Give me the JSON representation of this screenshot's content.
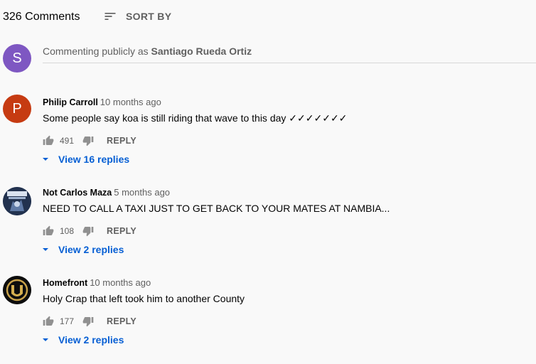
{
  "header": {
    "comment_count": "326 Comments",
    "sort_label": "SORT BY"
  },
  "compose": {
    "avatar_letter": "S",
    "avatar_color": "#7e57c2",
    "prefix": "Commenting publicly as ",
    "user_name": "Santiago Rueda Ortiz"
  },
  "comments": [
    {
      "author": "Philip Carroll",
      "time": "10 months ago",
      "text": "Some people say koa is still riding that wave to this day  ✓✓✓✓✓✓✓",
      "likes": "491",
      "reply_label": "REPLY",
      "view_replies": "View 16 replies",
      "avatar_letter": "P",
      "avatar_color": "#c63b12"
    },
    {
      "author": "Not Carlos Maza",
      "time": "5 months ago",
      "text": "NEED TO CALL A TAXI JUST TO GET BACK TO YOUR MATES AT NAMBIA...",
      "likes": "108",
      "reply_label": "REPLY",
      "view_replies": "View 2 replies"
    },
    {
      "author": "Homefront",
      "time": "10 months ago",
      "text": "Holy Crap that left took him to another County",
      "likes": "177",
      "reply_label": "REPLY",
      "view_replies": "View 2 replies"
    }
  ],
  "colors": {
    "link_blue": "#065fd4",
    "secondary_text": "#606060"
  }
}
